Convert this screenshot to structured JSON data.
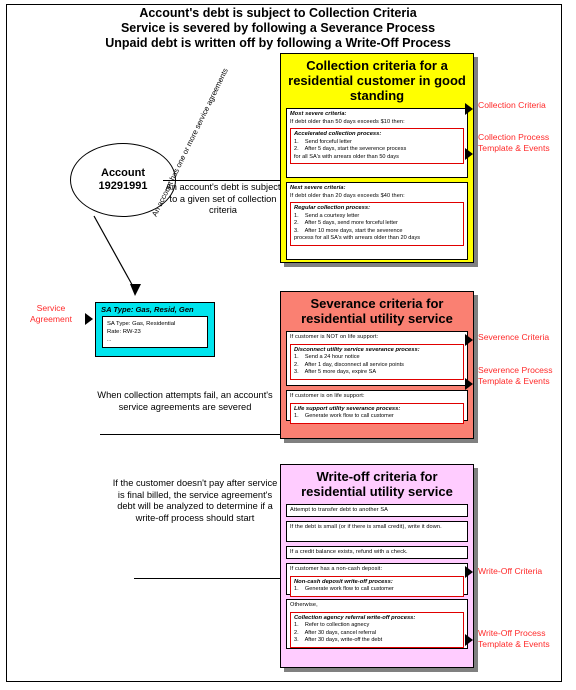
{
  "header": {
    "lines": [
      "Account's debt is subject to Collection Criteria",
      "Service is severed by following a Severance Process",
      "Unpaid debt is written off by following a Write-Off Process"
    ]
  },
  "account": {
    "label": "Account",
    "number": "19291991"
  },
  "notes": {
    "account_debt": "An account's debt is subject to a given set of collection criteria",
    "diagonal_sa": "An account has one or more service agreements",
    "severed": "When collection attempts fail, an account's service agreements are severed",
    "writeoff": "If the customer doesn't pay after service is final billed, the service agreement's debt will be analyzed to determine if a write-off process should start"
  },
  "service_agreement": {
    "left_label": "Service Agreement",
    "title": "SA Type: Gas, Resid, Gen",
    "detail_lines": [
      "SA Type: Gas, Residential",
      "Rate: RW-23",
      "..."
    ]
  },
  "collection": {
    "title": "Collection criteria for a residential customer in good standing",
    "labels": {
      "criteria": "Collection Criteria",
      "template": "Collection Process Template & Events"
    },
    "blocks": [
      {
        "lead": [
          "Most severe criteria:",
          "If debt older than 50 days exceeds $10 then:"
        ],
        "process_title": "Accelerated collection process:",
        "steps": [
          "1.    Send forceful letter",
          "2.    After 5 days, start the severence process"
        ],
        "continuation": "for all SA's with arrears older than 50 days"
      },
      {
        "lead": [
          "Next severe criteria:",
          "If debt older than 20 days exceeds $40 then:"
        ],
        "process_title": "Regular collection process:",
        "steps": [
          "1.    Send a courtesy letter",
          "2.    After 5 days, send more forceful letter",
          "3.    After 10 more days, start the severence"
        ],
        "continuation": "process for all SA's with arrears older than 20 days"
      }
    ]
  },
  "severance": {
    "title": "Severance criteria for residential utility service",
    "labels": {
      "criteria": "Severence Criteria",
      "template": "Severence Process Template & Events"
    },
    "blocks": [
      {
        "lead": [
          "If customer is NOT on life support:"
        ],
        "process_title": "Disconnect utility service severance process:",
        "steps": [
          "1.    Send a 24 hour notice",
          "2.    After 1 day, disconnect all service points",
          "3.    After 5 more days, expire SA"
        ],
        "continuation": ""
      },
      {
        "lead": [
          "If customer is on life support:"
        ],
        "process_title": "Life support utility severance process:",
        "steps": [
          "1.    Generate work flow to call customer"
        ],
        "continuation": ""
      }
    ]
  },
  "writeoff": {
    "title": "Write-off criteria for residential utility service",
    "labels": {
      "criteria": "Write-Off Criteria",
      "template": "Write-Off Process Template & Events"
    },
    "simple_blocks": [
      "Attempt to transfer debt to another SA",
      "If the debt is small (or if there is small credit), write it down.",
      "If a credit balance exists, refund with a check."
    ],
    "blocks": [
      {
        "lead": [
          "If customer has a non-cash deposit:"
        ],
        "process_title": "Non-cash deposit write-off process:",
        "steps": [
          "1.    Generate work flow to call customer"
        ],
        "continuation": ""
      },
      {
        "lead": [
          "Otherwise,"
        ],
        "process_title": "Collection agency referral write-off process:",
        "steps": [
          "1.    Refer to collection agnecy",
          "2.    After 30 days, cancel referral",
          "3.    After 30 days, write-off the debt"
        ],
        "continuation": ""
      }
    ]
  },
  "colors": {
    "collection": "#ffff00",
    "severance": "#fa8072",
    "writeoff": "#ffccff",
    "service_agreement": "#00e5ee",
    "annotation": "#ff2a2a",
    "process_border": "#e00000"
  }
}
